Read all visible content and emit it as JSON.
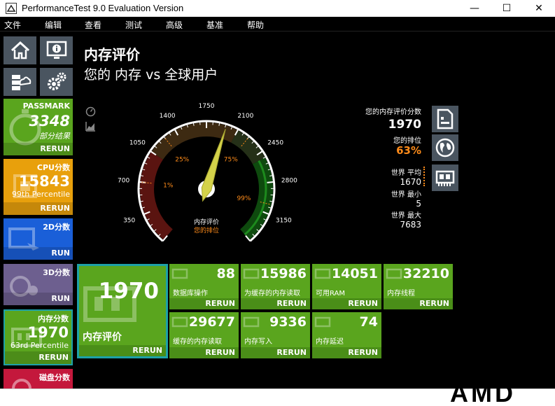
{
  "window": {
    "title": "PerformanceTest 9.0 Evaluation Version",
    "minimize": "—",
    "maximize": "☐",
    "close": "✕"
  },
  "menu": [
    "文件",
    "编辑",
    "查看",
    "测试",
    "高级",
    "基准",
    "帮助"
  ],
  "sidebar": {
    "tiles": [
      {
        "name": "PASSMARK",
        "score": "3348",
        "sub": "部分结果",
        "action": "RERUN",
        "color": "#5aa51e"
      },
      {
        "name": "CPU分数",
        "score": "15843",
        "sub": "99th Percentile",
        "action": "RERUN",
        "color": "#e8a00c"
      },
      {
        "name": "2D分数",
        "score": "",
        "sub": "",
        "action": "RUN",
        "color": "#1a5fd8"
      },
      {
        "name": "3D分数",
        "score": "",
        "sub": "",
        "action": "RUN",
        "color": "#6d5f8f"
      },
      {
        "name": "内存分数",
        "score": "1970",
        "sub": "63rd Percentile",
        "action": "RERUN",
        "color": "#5aa51e"
      },
      {
        "name": "磁盘分数",
        "score": "",
        "sub": "",
        "action": "",
        "color": "#c4183c"
      }
    ]
  },
  "header": {
    "title": "内存评价",
    "subtitle": "您的 内存 vs 全球用户"
  },
  "gauge": {
    "ticks": [
      "0",
      "350",
      "700",
      "1050",
      "1400",
      "1750",
      "2100",
      "2450",
      "2800",
      "3150",
      "3500"
    ],
    "band_labels": [
      "1%",
      "25%",
      "75%",
      "99%"
    ],
    "center_label": "内存评价",
    "center_sub": "您的排位",
    "value": 1970,
    "max": 3500
  },
  "right_panel": {
    "score_label": "您的内存评价分数",
    "score": "1970",
    "rank_label": "您的排位",
    "rank": "63%",
    "avg_label": "世界 平均",
    "avg": "1670",
    "min_label": "世界 最小",
    "min": "5",
    "max_label": "世界 最大",
    "max": "7683"
  },
  "results": {
    "main": {
      "value": "1970",
      "label": "内存评价",
      "action": "RERUN"
    },
    "tiles": [
      {
        "value": "88",
        "label": "数据库操作",
        "action": "RERUN"
      },
      {
        "value": "15986",
        "label": "为缓存的内存读取",
        "action": "RERUN"
      },
      {
        "value": "14051",
        "label": "可用RAM",
        "action": "RERUN"
      },
      {
        "value": "32210",
        "label": "内存线程",
        "action": "RERUN"
      },
      {
        "value": "29677",
        "label": "缓存的内存读取",
        "action": "RERUN"
      },
      {
        "value": "9336",
        "label": "内存写入",
        "action": "RERUN"
      },
      {
        "value": "74",
        "label": "内存延迟",
        "action": "RERUN"
      }
    ]
  },
  "footer": {
    "logo": "AMD"
  },
  "colors": {
    "tile_green": "#5aa51e",
    "rank_orange": "#ff8c1a",
    "gauge_needle": "#d4d24a"
  }
}
